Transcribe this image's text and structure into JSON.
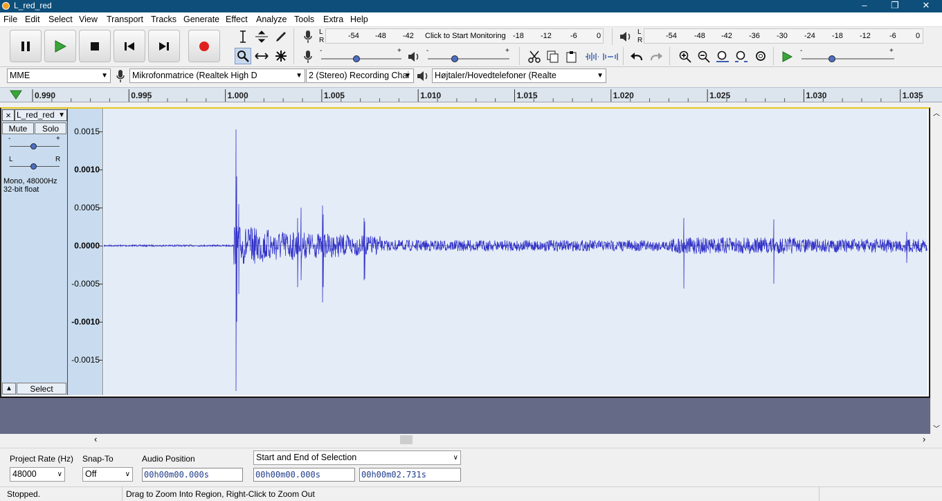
{
  "window": {
    "title": "L_red_red",
    "controls": [
      "–",
      "❐",
      "✕"
    ]
  },
  "menu": [
    "File",
    "Edit",
    "Select",
    "View",
    "Transport",
    "Tracks",
    "Generate",
    "Effect",
    "Analyze",
    "Tools",
    "Extra",
    "Help"
  ],
  "meters": {
    "record": {
      "lr": [
        "L",
        "R"
      ],
      "ticks": [
        "-54",
        "-48",
        "-42",
        "Click to Start Monitoring",
        "-18",
        "-12",
        "-6",
        "0"
      ]
    },
    "playback": {
      "lr": [
        "L",
        "R"
      ],
      "ticks": [
        "-54",
        "-48",
        "-42",
        "-36",
        "-30",
        "-24",
        "-18",
        "-12",
        "-6",
        "0"
      ]
    },
    "minus": "-",
    "plus": "+"
  },
  "device": {
    "host": "MME",
    "recording_device": "Mikrofonmatrice (Realtek High D",
    "channels": "2 (Stereo) Recording Chai",
    "playback_device": "Højtaler/Hovedtelefoner (Realte"
  },
  "ruler": {
    "ticks": [
      "0.990",
      "0.995",
      "1.000",
      "1.005",
      "1.010",
      "1.015",
      "1.020",
      "1.025",
      "1.030",
      "1.035"
    ]
  },
  "track": {
    "name": "L_red_red",
    "close": "×",
    "mute": "Mute",
    "solo": "Solo",
    "gain_minus": "-",
    "gain_plus": "+",
    "pan_left": "L",
    "pan_right": "R",
    "info_line1": "Mono, 48000Hz",
    "info_line2": "32-bit float",
    "select": "Select",
    "y_ticks": [
      "0.0015",
      "0.0010",
      "0.0005",
      "0.0000",
      "-0.0005",
      "-0.0010",
      "-0.0015"
    ],
    "wave_color": "#3232c8"
  },
  "selection_toolbar": {
    "project_rate_label": "Project Rate (Hz)",
    "project_rate": "48000",
    "snap_label": "Snap-To",
    "snap_value": "Off",
    "audio_position_label": "Audio Position",
    "audio_position": "00h00m00.000s",
    "selection_mode": "Start and End of Selection",
    "selection_start": "00h00m00.000s",
    "selection_end": "00h00m02.731s"
  },
  "status": {
    "state": "Stopped.",
    "hint": "Drag to Zoom Into Region, Right-Click to Zoom Out"
  }
}
